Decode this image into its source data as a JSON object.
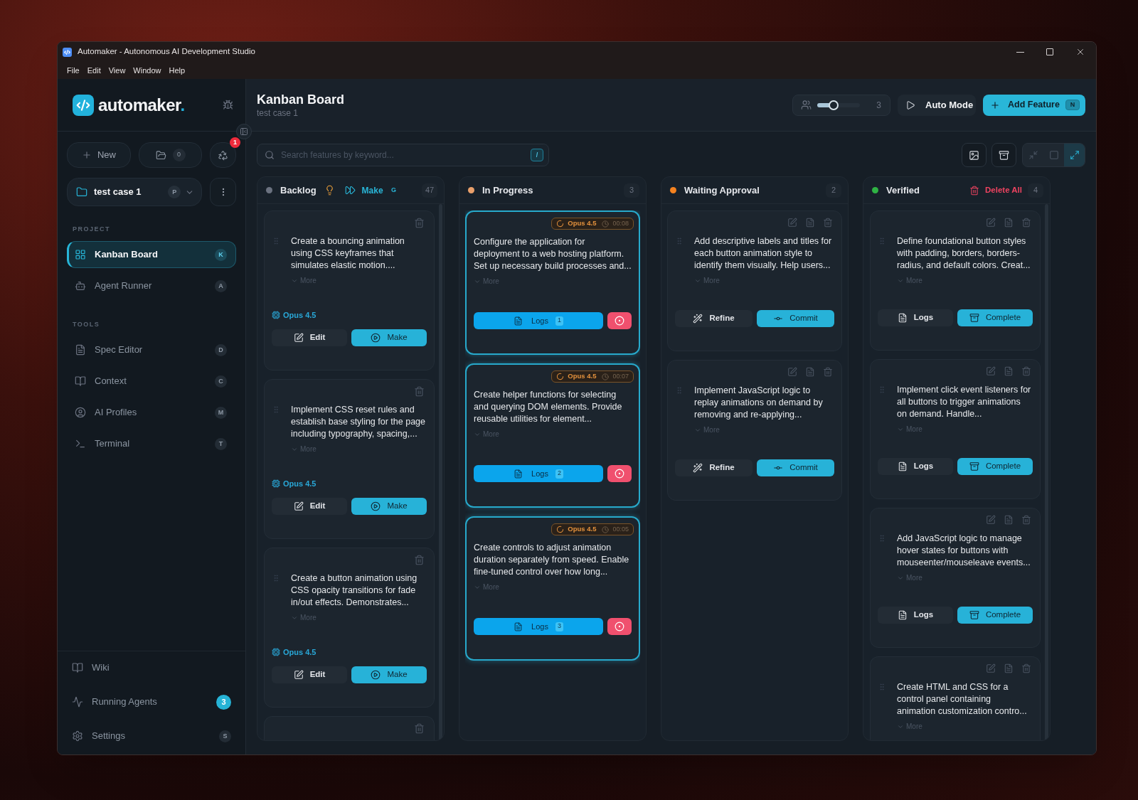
{
  "window": {
    "title": "Automaker - Autonomous AI Development Studio",
    "menu": [
      "File",
      "Edit",
      "View",
      "Window",
      "Help"
    ]
  },
  "sidebar": {
    "brand": {
      "name": "automaker",
      "dot": "."
    },
    "quick_actions": {
      "new_label": "New",
      "open_count": "0",
      "trash_badge": "1"
    },
    "project_selector": {
      "name": "test case 1",
      "shortcut": "P"
    },
    "sections": [
      {
        "label": "PROJECT",
        "items": [
          {
            "label": "Kanban Board",
            "shortcut": "K",
            "selected": true
          },
          {
            "label": "Agent Runner",
            "shortcut": "A",
            "selected": false
          }
        ]
      },
      {
        "label": "TOOLS",
        "items": [
          {
            "label": "Spec Editor",
            "shortcut": "D",
            "selected": false
          },
          {
            "label": "Context",
            "shortcut": "C",
            "selected": false
          },
          {
            "label": "AI Profiles",
            "shortcut": "M",
            "selected": false
          },
          {
            "label": "Terminal",
            "shortcut": "T",
            "selected": false
          }
        ]
      }
    ],
    "footer": [
      {
        "label": "Wiki"
      },
      {
        "label": "Running Agents",
        "badge": "3"
      },
      {
        "label": "Settings",
        "shortcut": "S"
      }
    ]
  },
  "header": {
    "title": "Kanban Board",
    "subtitle": "test case 1",
    "concurrency": {
      "level": 0.3,
      "value": "3"
    },
    "auto_mode": {
      "label": "Auto Mode"
    },
    "add_feature": {
      "label": "Add Feature",
      "shortcut": "N"
    }
  },
  "toolbar": {
    "search": {
      "placeholder": "Search features by keyword...",
      "shortcut": "/"
    },
    "view_modes": [
      {
        "selected": false
      },
      {
        "selected": false
      },
      {
        "selected": true
      }
    ]
  },
  "columns": [
    {
      "kind": "backlog",
      "title": "Backlog",
      "color": "#6b7280",
      "count": "47",
      "make": {
        "label": "Make",
        "shortcut": "G"
      },
      "cards": [
        {
          "description": "Create a bouncing animation using CSS keyframes that simulates elastic motion....",
          "more": "More",
          "model": "Opus 4.5",
          "actions": [
            "Edit",
            "Make"
          ]
        },
        {
          "description": "Implement CSS reset rules and establish base styling for the page including typography, spacing,...",
          "more": "More",
          "model": "Opus 4.5",
          "actions": [
            "Edit",
            "Make"
          ]
        },
        {
          "description": "Create a button animation using CSS opacity transitions for fade in/out effects. Demonstrates...",
          "more": "More",
          "model": "Opus 4.5",
          "actions": [
            "Edit",
            "Make"
          ]
        },
        {
          "cut_off": true
        }
      ]
    },
    {
      "kind": "in_progress",
      "title": "In Progress",
      "color": "#e9a06b",
      "count": "3",
      "cards": [
        {
          "model": "Opus 4.5",
          "elapsed": "00:08",
          "description": "Configure the application for deployment to a web hosting platform. Set up necessary build processes and...",
          "more": "More",
          "logs": {
            "label": "Logs",
            "count": "1"
          }
        },
        {
          "model": "Opus 4.5",
          "elapsed": "00:07",
          "description": "Create helper functions for selecting and querying DOM elements. Provide reusable utilities for element...",
          "more": "More",
          "logs": {
            "label": "Logs",
            "count": "2"
          }
        },
        {
          "model": "Opus 4.5",
          "elapsed": "00:05",
          "description": "Create controls to adjust animation duration separately from speed. Enable fine-tuned control over how long...",
          "more": "More",
          "logs": {
            "label": "Logs",
            "count": "3"
          }
        }
      ]
    },
    {
      "kind": "waiting",
      "title": "Waiting Approval",
      "color": "#f5821f",
      "count": "2",
      "cards": [
        {
          "description": "Add descriptive labels and titles for each button animation style to identify them visually. Help users...",
          "more": "More",
          "actions": [
            "Refine",
            "Commit"
          ]
        },
        {
          "description": "Implement JavaScript logic to replay animations on demand by removing and re-applying...",
          "more": "More",
          "actions": [
            "Refine",
            "Commit"
          ]
        }
      ]
    },
    {
      "kind": "verified",
      "title": "Verified",
      "color": "#2fb344",
      "count": "4",
      "delete_all": "Delete All",
      "cards": [
        {
          "description": "Define foundational button styles with padding, borders, borders-radius, and default colors. Creat...",
          "more": "More",
          "actions": [
            "Logs",
            "Complete"
          ]
        },
        {
          "description": "Implement click event listeners for all buttons to trigger animations on demand. Handle...",
          "more": "More",
          "actions": [
            "Logs",
            "Complete"
          ]
        },
        {
          "description": "Add JavaScript logic to manage hover states for buttons with mouseenter/mouseleave events...",
          "more": "More",
          "actions": [
            "Logs",
            "Complete"
          ]
        },
        {
          "description": "Create HTML and CSS for a control panel containing animation customization contro...",
          "more": "More",
          "cut_off": true
        }
      ]
    }
  ]
}
